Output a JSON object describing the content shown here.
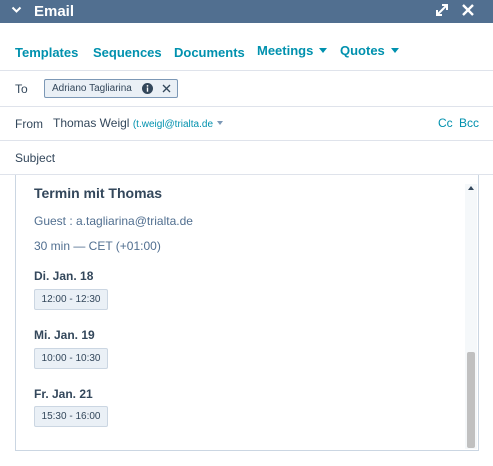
{
  "header": {
    "title": "Email",
    "chevron_icon": "chevron-down-icon",
    "expand_icon": "expand-icon",
    "close_icon": "close-icon",
    "bg_color": "#516f90"
  },
  "toolbar": {
    "templates": "Templates",
    "sequences": "Sequences",
    "documents": "Documents",
    "meetings": "Meetings",
    "quotes": "Quotes"
  },
  "to": {
    "label": "To",
    "recipient": "Adriano Tagliarina"
  },
  "from": {
    "label": "From",
    "name": "Thomas Weigl",
    "email_prefix": "(",
    "email": "t.weigl@trialta.de",
    "cc": "Cc",
    "bcc": "Bcc"
  },
  "subject": {
    "label": "Subject",
    "value": ""
  },
  "body": {
    "title": "Termin mit Thomas",
    "guest": "Guest : a.tagliarina@trialta.de",
    "duration": "30 min — CET (+01:00)",
    "days": [
      {
        "day": "Di. Jan. 18",
        "slot": "12:00 - 12:30"
      },
      {
        "day": "Mi. Jan. 19",
        "slot": "10:00 - 10:30"
      },
      {
        "day": "Fr. Jan. 21",
        "slot": "15:30 - 16:00"
      }
    ]
  },
  "colors": {
    "link": "#0091ae",
    "text": "#33475b",
    "chip_bg": "#eaf0f6"
  }
}
